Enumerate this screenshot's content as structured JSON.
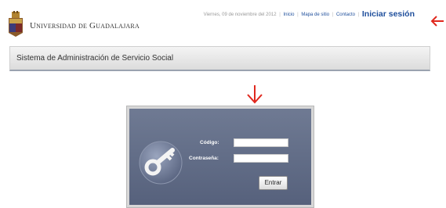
{
  "header": {
    "university_name": "Universidad de Guadalajara",
    "date_text": "Viernes, 09 de noviembre del 2012",
    "nav": {
      "home": "Inicio",
      "sitemap": "Mapa de sitio",
      "contact": "Contacto",
      "login": "Iniciar sesión"
    }
  },
  "title_bar": {
    "title": "Sistema de Administración de Servicio Social"
  },
  "login": {
    "code_label": "Código:",
    "password_label": "Contraseña:",
    "submit_label": "Entrar"
  },
  "annotations": {
    "arrow_color": "#e0281e"
  },
  "colors": {
    "panel_top": "#6f7a93",
    "panel_bottom": "#56617c",
    "link_blue": "#1f4f9c"
  }
}
